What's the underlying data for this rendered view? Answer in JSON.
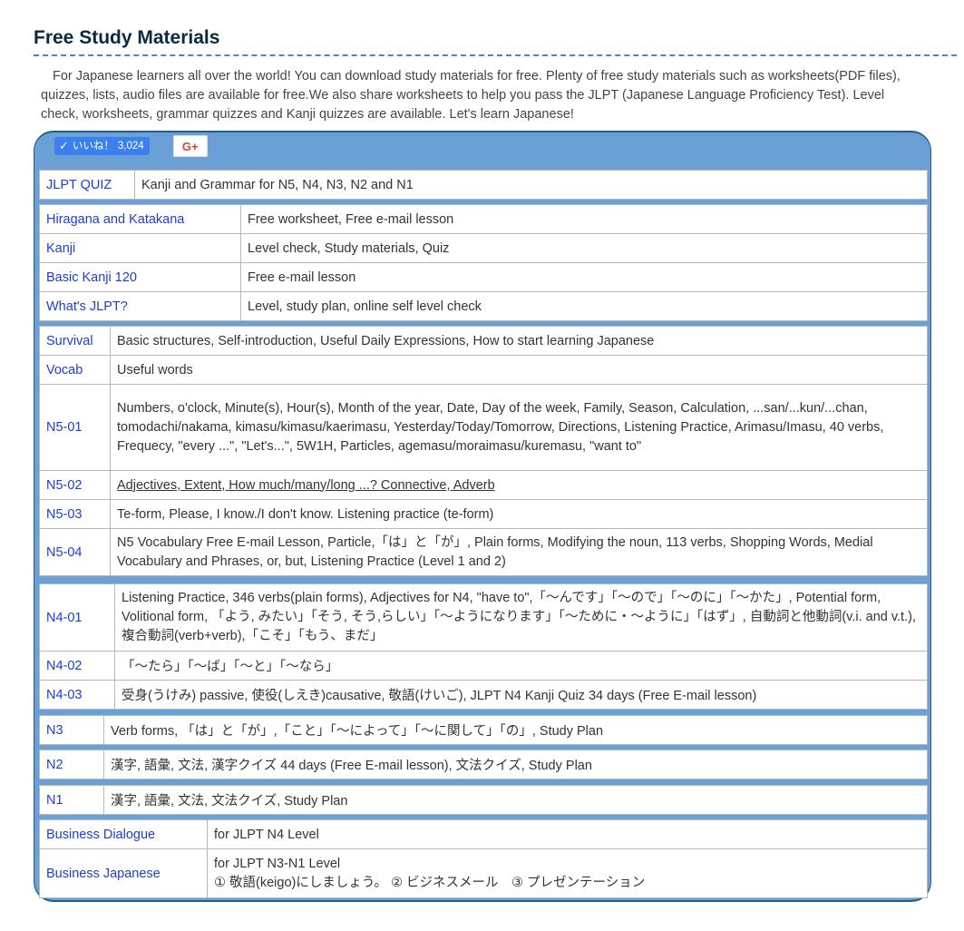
{
  "page": {
    "title": "Free Study Materials",
    "intro": "For Japanese learners all over the world! You can download study materials for free. Plenty of free study materials such as worksheets(PDF files), quizzes, lists, audio files are available for free.We also share worksheets to help you pass the JLPT (Japanese Language Proficiency Test). Level check, worksheets, grammar quizzes and Kanji quizzes are available. Let's learn Japanese!"
  },
  "social": {
    "like_label": "いいね！",
    "like_count": "3,024",
    "gplus_label": "G+"
  },
  "colors": {
    "panel": "#6aa0d6",
    "link": "#1b3fd1",
    "title": "#0c2a3f"
  },
  "tables": {
    "quiz": [
      {
        "key": "JLPT QUIZ",
        "value": "Kanji and Grammar for N5, N4, N3, N2 and N1"
      }
    ],
    "basics": [
      {
        "key": "Hiragana and Katakana",
        "value": "Free worksheet, Free e-mail lesson"
      },
      {
        "key": "Kanji",
        "value": "Level check, Study materials, Quiz"
      },
      {
        "key": "Basic Kanji 120",
        "value": "Free e-mail lesson"
      },
      {
        "key": "What's JLPT?",
        "value": "Level, study plan, online self level check"
      }
    ],
    "n5": [
      {
        "key": "Survival",
        "value": "Basic structures, Self-introduction, Useful Daily Expressions, How to start learning Japanese"
      },
      {
        "key": "Vocab",
        "value": "Useful words"
      },
      {
        "key": "N5-01",
        "value": "Numbers, o'clock, Minute(s), Hour(s), Month of the year, Date, Day of the week, Family, Season, Calculation, ...san/...kun/...chan, tomodachi/nakama, kimasu/kimasu/kaerimasu, Yesterday/Today/Tomorrow, Directions, Listening Practice, Arimasu/Imasu, 40 verbs, Frequecy, \"every ...\", \"Let's...\", 5W1H, Particles, agemasu/moraimasu/kuremasu, \"want to\""
      },
      {
        "key": "N5-02",
        "value": "Adjectives, Extent, How much/many/long ...? Connective, Adverb"
      },
      {
        "key": "N5-03",
        "value": "Te-form, Please, I know./I don't know. Listening practice (te-form)"
      },
      {
        "key": "N5-04",
        "value": "N5 Vocabulary Free E-mail Lesson, Particle,「は」と「が」, Plain forms, Modifying the noun, 113 verbs, Shopping Words, Medial Vocabulary and Phrases, or, but, Listening Practice (Level 1 and 2)"
      }
    ],
    "n4": [
      {
        "key": "N4-01",
        "value": "Listening Practice, 346 verbs(plain forms), Adjectives for N4, \"have to\",「〜んです」「〜ので」「〜のに」「〜かた」, Potential form, Volitional form, 「よう, みたい」「そう, そう,らしい」「〜ようになります」「〜ために・〜ように」「はず」, 自動詞と他動詞(v.i. and v.t.), 複合動詞(verb+verb),「こそ」「もう、まだ」"
      },
      {
        "key": "N4-02",
        "value": "「〜たら」「〜ば」「〜と」「〜なら」"
      },
      {
        "key": "N4-03",
        "value": "受身(うけみ) passive, 使役(しえき)causative, 敬語(けいご), JLPT N4 Kanji Quiz 34 days (Free E-mail lesson)"
      }
    ],
    "n3": [
      {
        "key": "N3",
        "value": "Verb forms, 「は」と「が」,「こと」「〜によって」「〜に関して」「の」, Study Plan"
      }
    ],
    "n2": [
      {
        "key": "N2",
        "value": "漢字, 語彙, 文法, 漢字クイズ 44 days (Free E-mail lesson), 文法クイズ, Study Plan"
      }
    ],
    "n1": [
      {
        "key": "N1",
        "value": "漢字, 語彙, 文法, 文法クイズ, Study Plan"
      }
    ],
    "business": [
      {
        "key": "Business Dialogue",
        "value": "for JLPT N4 Level"
      },
      {
        "key": "Business Japanese",
        "value": "for JLPT N3-N1 Level",
        "value2": "① 敬語(keigo)にしましょう。 ② ビジネスメール　③ プレゼンテーション"
      }
    ]
  }
}
